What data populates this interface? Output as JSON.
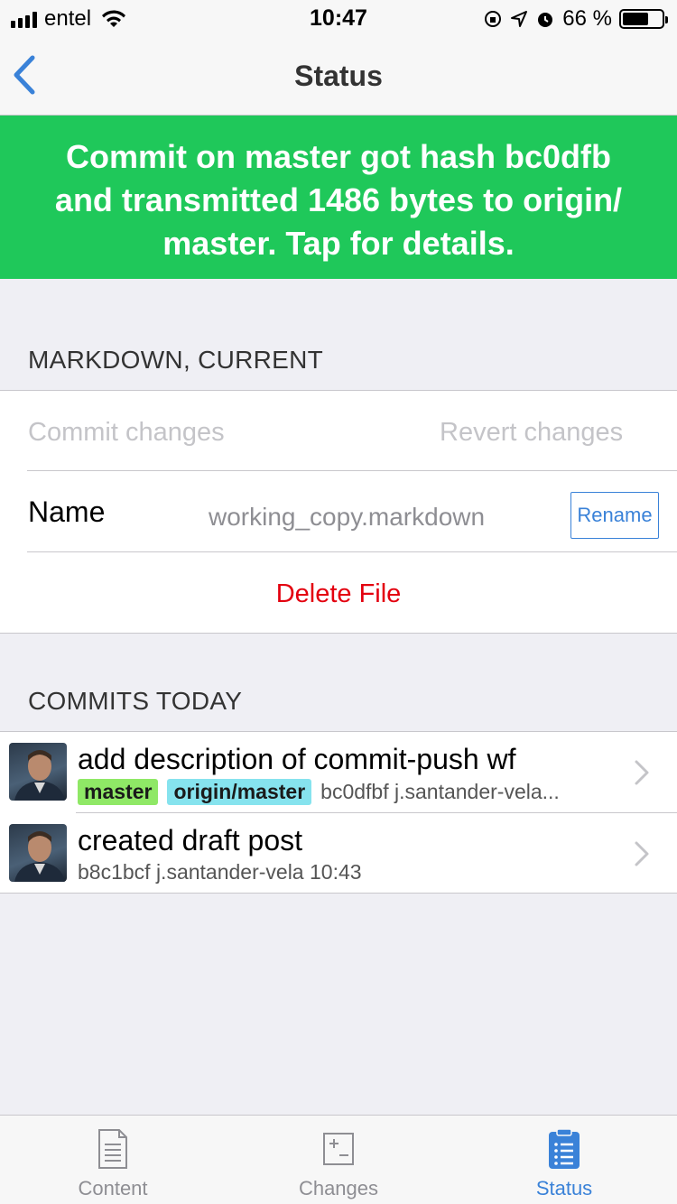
{
  "status_bar": {
    "carrier": "entel",
    "time": "10:47",
    "battery_percent": "66 %",
    "battery_level": 0.66
  },
  "nav": {
    "title": "Status",
    "back_icon": "chevron-left-icon"
  },
  "banner": {
    "text": "Commit on master got hash bc0dfb and transmitted 1486 bytes to origin/ master. Tap for details.",
    "color": "#1fc85a"
  },
  "file_section": {
    "header": "MARKDOWN, CURRENT",
    "commit_changes": "Commit changes",
    "revert_changes": "Revert changes",
    "name_label": "Name",
    "name_value": "working_copy.markdown",
    "rename_label": "Rename",
    "delete_label": "Delete File"
  },
  "commits_section": {
    "header": "COMMITS TODAY",
    "commits": [
      {
        "title": "add description of commit-push wf",
        "tags": [
          "master",
          "origin/master"
        ],
        "meta": "bc0dfbf j.santander-vela..."
      },
      {
        "title": "created draft post",
        "tags": [],
        "meta": "b8c1bcf j.santander-vela 10:43"
      }
    ]
  },
  "tabs": [
    {
      "label": "Content",
      "icon": "document-icon",
      "active": false
    },
    {
      "label": "Changes",
      "icon": "diff-icon",
      "active": false
    },
    {
      "label": "Status",
      "icon": "clipboard-list-icon",
      "active": true
    }
  ],
  "colors": {
    "accent": "#3a82d8",
    "destructive": "#e3000f",
    "tag_master": "#8fe866",
    "tag_origin": "#86e3ee"
  }
}
